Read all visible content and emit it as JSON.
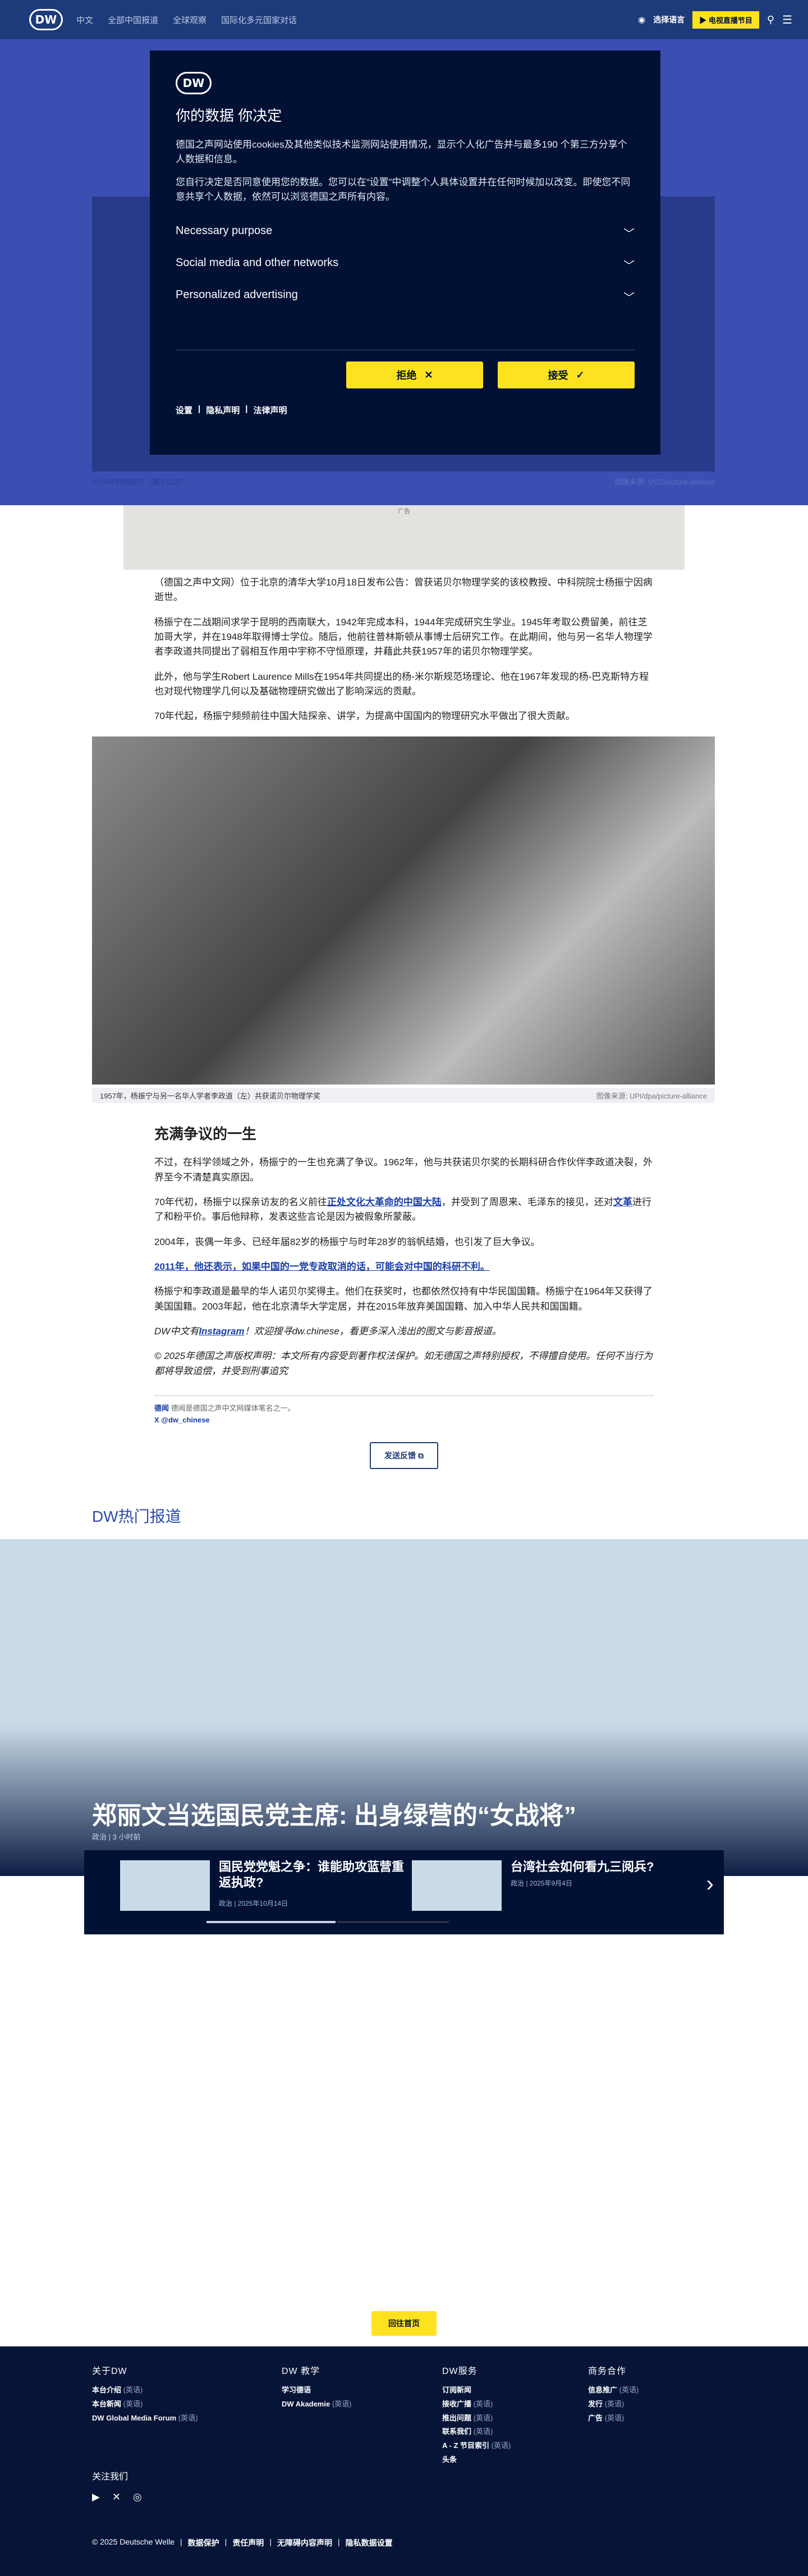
{
  "nav": {
    "logo": "DW",
    "links": [
      "中文",
      "全部中国报道",
      "全球观察",
      "国际化多元国家对话"
    ],
    "lang_label": "选择语言",
    "live_label": "▶ 电视直播节目"
  },
  "hero_caption": {
    "left": "2016年的照振宁（摄于北京）",
    "right": "图像来源: VCG/picture-alliance"
  },
  "consent": {
    "logo": "DW",
    "title": "你的数据 你决定",
    "p1": "德国之声网站使用cookies及其他类似技术监测网站使用情况，显示个人化广告并与最多190 个第三方分享个人数据和信息。",
    "p2": "您自行决定是否同意使用您的数据。您可以在“设置”中调整个人具体设置并在任何时候加以改变。即使您不同意共享个人数据，依然可以浏览德国之声所有内容。",
    "sections": [
      "Necessary purpose",
      "Social media and other networks",
      "Personalized advertising"
    ],
    "reject": "拒绝",
    "accept": "接受",
    "links": [
      "设置",
      "隐私声明",
      "法律声明"
    ]
  },
  "ad_label": "广告",
  "article": {
    "p1": "（德国之声中文网）位于北京的清华大学10月18日发布公告：曾获诺贝尔物理学奖的该校教授、中科院院士杨振宁因病逝世。",
    "p2": "杨振宁在二战期间求学于昆明的西南联大，1942年完成本科，1944年完成研究生学业。1945年考取公费留美，前往芝加哥大学，并在1948年取得博士学位。随后，他前往普林斯顿从事博士后研究工作。在此期间，他与另一名华人物理学者李政道共同提出了弱相互作用中宇称不守恒原理，并藉此共获1957年的诺贝尔物理学奖。",
    "p3": "此外，他与学生Robert Laurence Mills在1954年共同提出的杨-米尔斯规范场理论、他在1967年发现的杨-巴克斯特方程也对现代物理学几何以及基础物理研究做出了影响深远的贡献。",
    "p4": "70年代起，杨振宁频频前往中国大陆探亲、讲学，为提高中国国内的物理研究水平做出了很大贡献。",
    "photo_caption": "1957年，杨振宁与另一名华人学者李政道（左）共获诺贝尔物理学奖",
    "photo_credit": "图像来源: UPI/dpa/picture-alliance",
    "h2": "充满争议的一生",
    "p5": "不过，在科学领域之外，杨振宁的一生也充满了争议。1962年，他与共获诺贝尔奖的长期科研合作伙伴李政道决裂，外界至今不清楚真实原因。",
    "p6a": "70年代初，杨振宁以探亲访友的名义前往",
    "p6link": "正处文化大革命的中国大陆",
    "p6b": "，并受到了周恩来、毛泽东的接见，还对",
    "p6link2": "文革",
    "p6c": "进行了和粉平价。事后他辩称，发表这些言论是因为被假象所蒙蔽。",
    "p7": "2004年，丧偶一年多、已经年届82岁的杨振宁与时年28岁的翁帆结婚，也引发了巨大争议。",
    "p8": "2011年，他还表示，如果中国的一党专政取消的话，可能会对中国的科研不利。",
    "p9": "杨振宁和李政道是最早的华人诺贝尔奖得主。他们在获奖时，也都依然仅持有中华民国国籍。杨振宁在1964年又获得了美国国籍。2003年起，他在北京清华大学定居，并在2015年放弃美国国籍、加入中华人民共和国国籍。",
    "p10a": "DW中文有",
    "p10link": "Instagram",
    "p10b": "！欢迎搜寻dw.chinese，看更多深入浅出的图文与影音报道。",
    "p11": "© 2025年德国之声版权声明：本文所有内容受到著作权法保护。如无德国之声特别授权，不得擅自使用。任何不当行为都将导致追偿，并受到刑事追究",
    "byline_tag": "德闻",
    "byline_text": "德闻是德国之声中文网媒体笔名之一。",
    "byline_handle": "X @dw_chinese",
    "feedback": "发送反馈"
  },
  "hot": {
    "heading": "DW热门报道",
    "title": "郑丽文当选国民党主席: 出身绿营的“女战将”",
    "meta": "政治 | 3 小时前",
    "cards": [
      {
        "title": "国民党党魁之争：谁能助攻蓝营重返执政?",
        "meta": "政治 | 2025年10月14日"
      },
      {
        "title": "台湾社会如何看九三阅兵?",
        "meta": "政治 | 2025年9月4日"
      }
    ],
    "next_icon": "›"
  },
  "back_top": "回往首页",
  "footer": {
    "cols": [
      {
        "title": "关于DW",
        "items": [
          {
            "label": "本台介绍",
            "sub": "(英语)"
          },
          {
            "label": "本台新闻",
            "sub": "(英语)"
          },
          {
            "label": "DW Global Media Forum",
            "sub": "(英语)"
          }
        ]
      },
      {
        "title": "DW 教学",
        "items": [
          {
            "label": "学习德语",
            "sub": ""
          },
          {
            "label": "DW Akademie",
            "sub": "(英语)"
          }
        ]
      },
      {
        "title": "DW服务",
        "items": [
          {
            "label": "订阅新闻",
            "sub": ""
          },
          {
            "label": "接收广播",
            "sub": "(英语)"
          },
          {
            "label": "推出问题",
            "sub": "(英语)"
          },
          {
            "label": "联系我们",
            "sub": "(英语)"
          },
          {
            "label": "A - Z 节目索引",
            "sub": "(英语)"
          },
          {
            "label": "头条",
            "sub": ""
          }
        ]
      },
      {
        "title": "商务合作",
        "items": [
          {
            "label": "信息推广",
            "sub": "(英语)"
          },
          {
            "label": "发行",
            "sub": "(英语)"
          },
          {
            "label": "广告",
            "sub": "(英语)"
          }
        ]
      }
    ],
    "follow": "关注我们",
    "bottom": [
      "© 2025 Deutsche Welle",
      "数据保护",
      "责任声明",
      "无障碍内容声明",
      "隐私数据设置"
    ]
  }
}
